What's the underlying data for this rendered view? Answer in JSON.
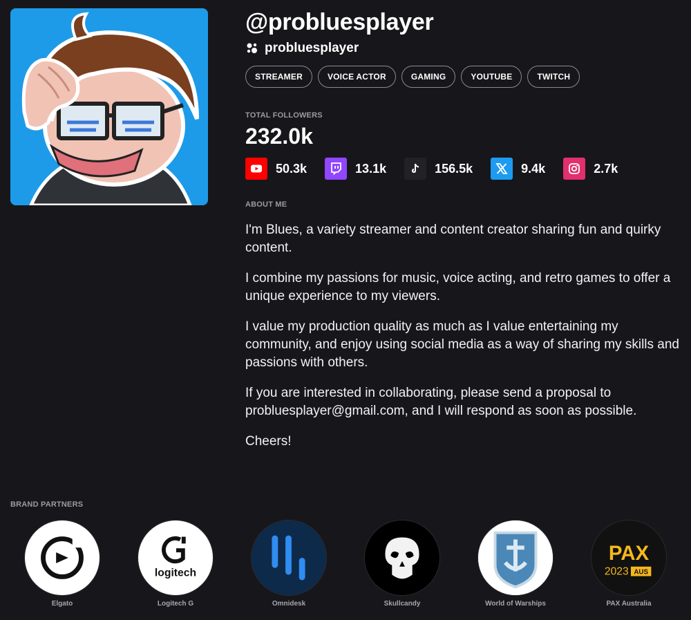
{
  "profile": {
    "handle": "@probluesplayer",
    "username": "probluesplayer",
    "tags": [
      "STREAMER",
      "VOICE ACTOR",
      "GAMING",
      "YOUTUBE",
      "TWITCH"
    ],
    "total_followers_label": "TOTAL FOLLOWERS",
    "total_followers": "232.0k",
    "platforms": [
      {
        "name": "youtube-icon",
        "count": "50.3k",
        "color": "#ff0000"
      },
      {
        "name": "twitch-icon",
        "count": "13.1k",
        "color": "#9146ff"
      },
      {
        "name": "tiktok-icon",
        "count": "156.5k",
        "color": "#222226"
      },
      {
        "name": "x-icon",
        "count": "9.4k",
        "color": "#1d9bf0"
      },
      {
        "name": "instagram-icon",
        "count": "2.7k",
        "color": "#e1306c"
      }
    ],
    "about_label": "ABOUT ME",
    "about": [
      "I'm Blues, a variety streamer and content creator sharing fun and quirky content.",
      "I combine my passions for music, voice acting, and retro games to offer a unique experience to my viewers.",
      "I value my production quality as much as I value entertaining my community, and enjoy using social media as a way of sharing my skills and passions with others.",
      "If you are interested in collaborating, please send a proposal to probluesplayer@gmail.com, and I will respond as soon as possible.",
      "Cheers!"
    ]
  },
  "brands": {
    "label": "BRAND PARTNERS",
    "items": [
      {
        "name": "Elgato",
        "logo": "elgato-logo"
      },
      {
        "name": "Logitech G",
        "logo": "logitech-logo",
        "logo_text": "logitech"
      },
      {
        "name": "Omnidesk",
        "logo": "omnidesk-logo"
      },
      {
        "name": "Skullcandy",
        "logo": "skullcandy-logo"
      },
      {
        "name": "World of Warships",
        "logo": "world-of-warships-logo"
      },
      {
        "name": "PAX Australia",
        "logo": "pax-logo",
        "logo_text": "PAX",
        "logo_year": "2023",
        "logo_region": "AUS"
      }
    ]
  },
  "colors": {
    "background": "#17171b",
    "avatar_bg": "#1e9be8",
    "muted_text": "#9a9aa2"
  }
}
